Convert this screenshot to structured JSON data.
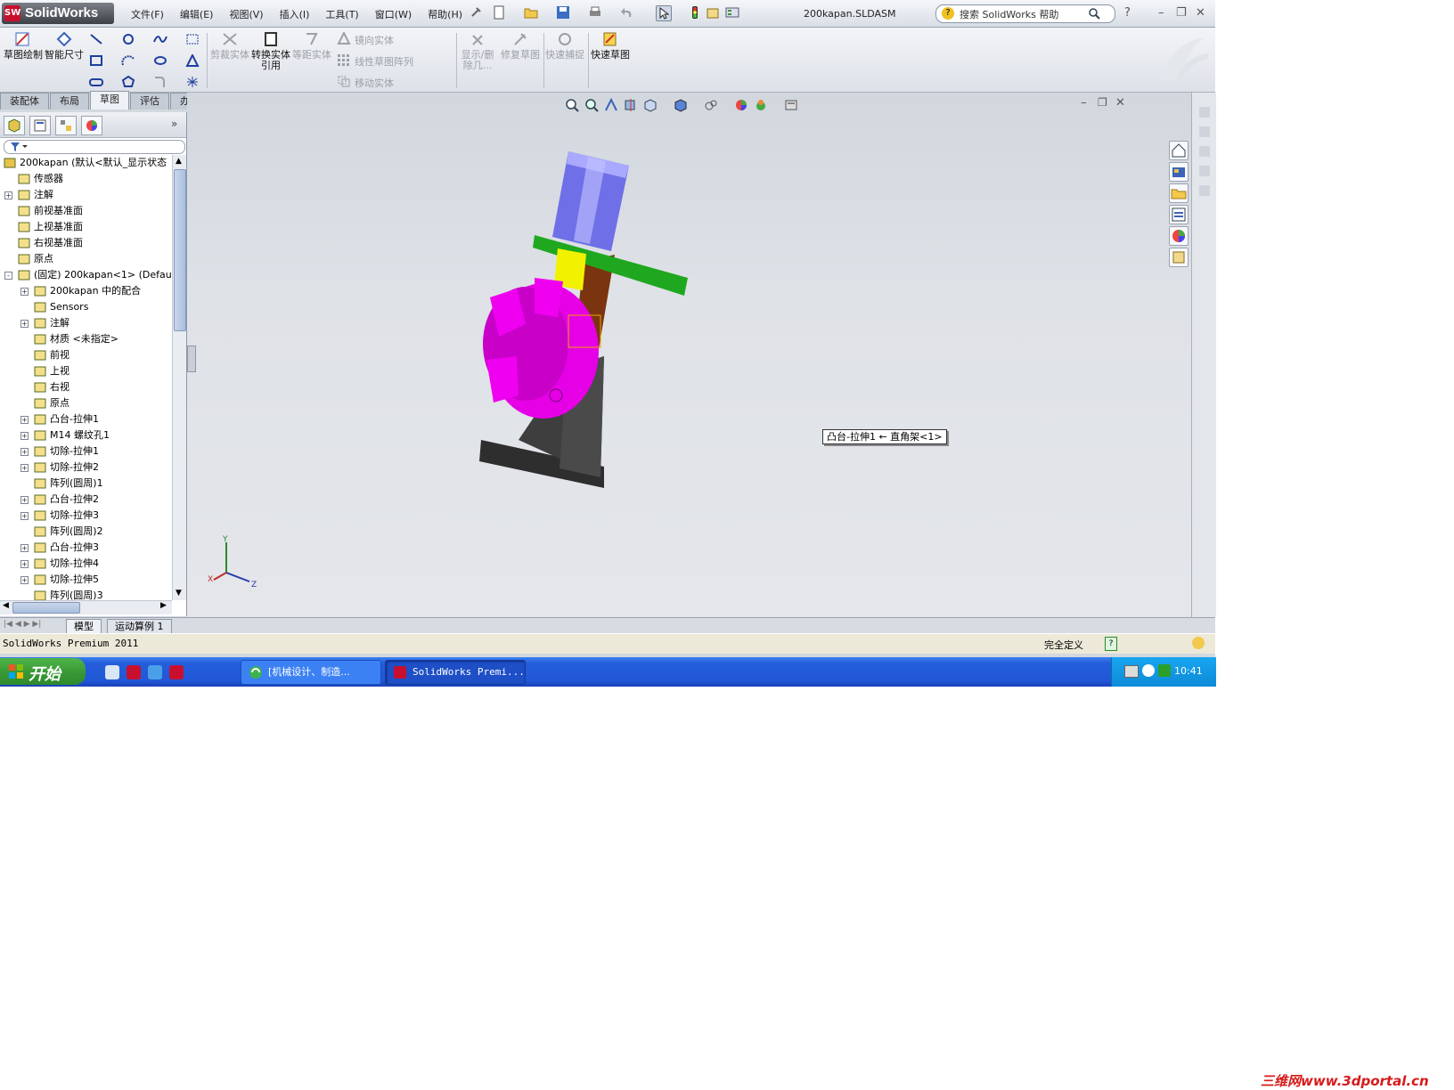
{
  "app": {
    "logo": "SolidWorks",
    "menus": [
      "文件(F)",
      "编辑(E)",
      "视图(V)",
      "插入(I)",
      "工具(T)",
      "窗口(W)",
      "帮助(H)"
    ],
    "document_title": "200kapan.SLDASM",
    "search_placeholder": "搜索 SolidWorks 帮助"
  },
  "command_manager": {
    "buttons": {
      "sketch": "草图绘制",
      "smart_dim": "智能尺寸",
      "trim": "剪裁实体",
      "convert": "转换实体引用",
      "offset": "等距实体",
      "mirror": "镜向实体",
      "linear_pattern": "线性草图阵列",
      "move": "移动实体",
      "show_delete": "显示/删除几...",
      "repair": "修复草图",
      "quick_snap": "快速捕捉",
      "rapid_sketch": "快速草图"
    }
  },
  "tabs": [
    "装配体",
    "布局",
    "草图",
    "评估",
    "办公室产品"
  ],
  "active_tab": "草图",
  "tree": [
    {
      "label": "200kapan  (默认<默认_显示状态",
      "level": 0,
      "expand": ""
    },
    {
      "label": "传感器",
      "level": 1,
      "expand": ""
    },
    {
      "label": "注解",
      "level": 1,
      "expand": "+"
    },
    {
      "label": "前视基准面",
      "level": 1,
      "expand": ""
    },
    {
      "label": "上视基准面",
      "level": 1,
      "expand": ""
    },
    {
      "label": "右视基准面",
      "level": 1,
      "expand": ""
    },
    {
      "label": "原点",
      "level": 1,
      "expand": ""
    },
    {
      "label": "(固定) 200kapan<1> (Defau",
      "level": 1,
      "expand": "-"
    },
    {
      "label": "200kapan 中的配合",
      "level": 2,
      "expand": "+"
    },
    {
      "label": "Sensors",
      "level": 2,
      "expand": ""
    },
    {
      "label": "注解",
      "level": 2,
      "expand": "+"
    },
    {
      "label": "材质 <未指定>",
      "level": 2,
      "expand": ""
    },
    {
      "label": "前视",
      "level": 2,
      "expand": ""
    },
    {
      "label": "上视",
      "level": 2,
      "expand": ""
    },
    {
      "label": "右视",
      "level": 2,
      "expand": ""
    },
    {
      "label": "原点",
      "level": 2,
      "expand": ""
    },
    {
      "label": "凸台-拉伸1",
      "level": 2,
      "expand": "+"
    },
    {
      "label": "M14 螺纹孔1",
      "level": 2,
      "expand": "+"
    },
    {
      "label": "切除-拉伸1",
      "level": 2,
      "expand": "+"
    },
    {
      "label": "切除-拉伸2",
      "level": 2,
      "expand": "+"
    },
    {
      "label": "阵列(圆周)1",
      "level": 2,
      "expand": ""
    },
    {
      "label": "凸台-拉伸2",
      "level": 2,
      "expand": "+"
    },
    {
      "label": "切除-拉伸3",
      "level": 2,
      "expand": "+"
    },
    {
      "label": "阵列(圆周)2",
      "level": 2,
      "expand": ""
    },
    {
      "label": "凸台-拉伸3",
      "level": 2,
      "expand": "+"
    },
    {
      "label": "切除-拉伸4",
      "level": 2,
      "expand": "+"
    },
    {
      "label": "切除-拉伸5",
      "level": 2,
      "expand": "+"
    },
    {
      "label": "阵列(圆周)3",
      "level": 2,
      "expand": ""
    }
  ],
  "viewport": {
    "callout": "凸台-拉伸1 ← 直角架<1>",
    "triad": {
      "x": "X",
      "y": "Y",
      "z": "Z"
    }
  },
  "bottom_tabs": [
    "模型",
    "运动算例 1"
  ],
  "status": {
    "left": "SolidWorks Premium 2011",
    "right": "完全定义"
  },
  "taskbar": {
    "start": "开始",
    "tasks": [
      "[机械设计、制造...",
      "SolidWorks Premi..."
    ],
    "clock": "10:41"
  },
  "watermark": "三维网www.3dportal.cn",
  "colors": {
    "chuck": "#e600e6",
    "motor": "#7b7bf0",
    "plate": "#1fa81f",
    "bracket": "#8b3e12",
    "coupling": "#f2f200",
    "base": "#3d3d3d"
  }
}
